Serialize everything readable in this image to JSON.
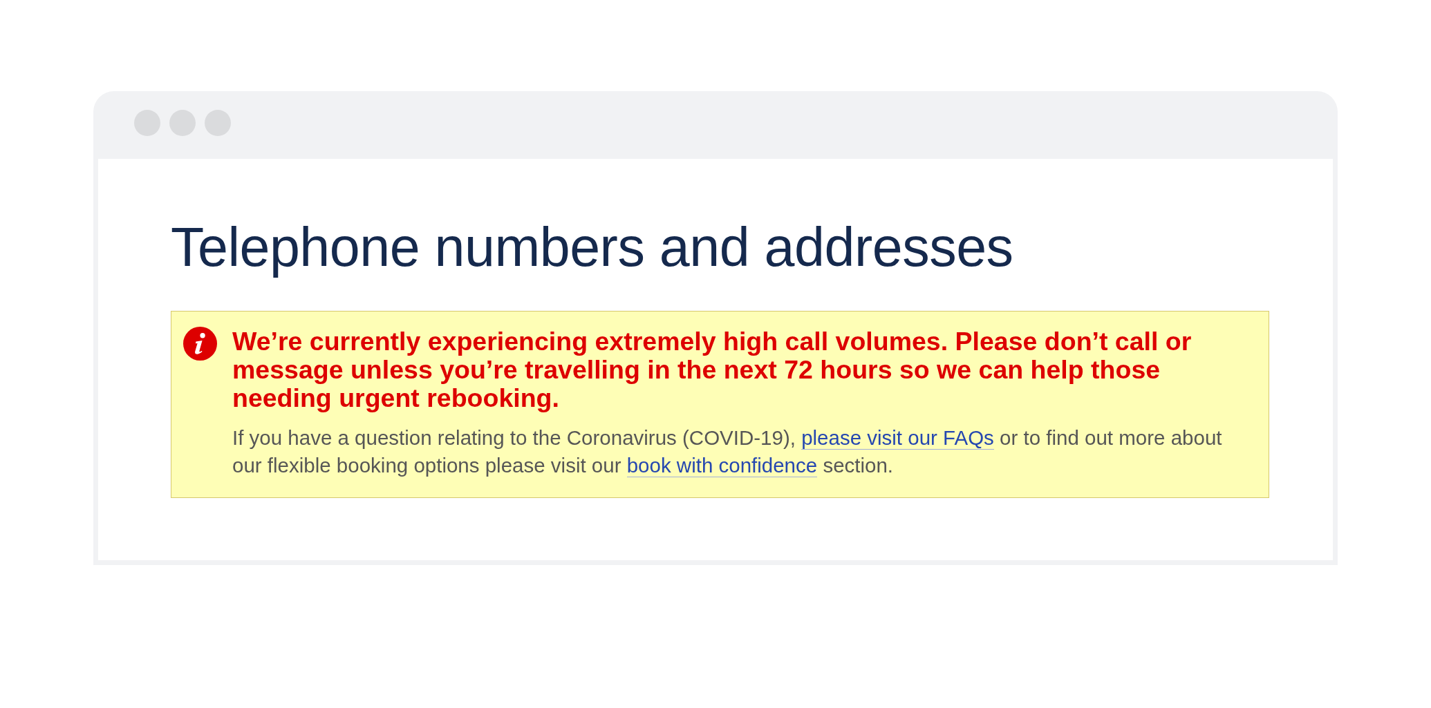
{
  "page": {
    "title": "Telephone numbers and addresses"
  },
  "notice": {
    "kind": "info",
    "heading": "We’re currently experiencing extremely high call volumes. Please don’t call or message unless you’re travelling in the next 72 hours so we can help those needing urgent rebooking.",
    "body": [
      {
        "kind": "text",
        "text": "If you have a question relating to the Coronavirus (COVID-19), "
      },
      {
        "kind": "link",
        "text": "please visit our FAQs"
      },
      {
        "kind": "text",
        "text": " or to find out more about our flexible booking options please visit our "
      },
      {
        "kind": "link",
        "text": "book with confidence"
      },
      {
        "kind": "text",
        "text": " section."
      }
    ]
  }
}
